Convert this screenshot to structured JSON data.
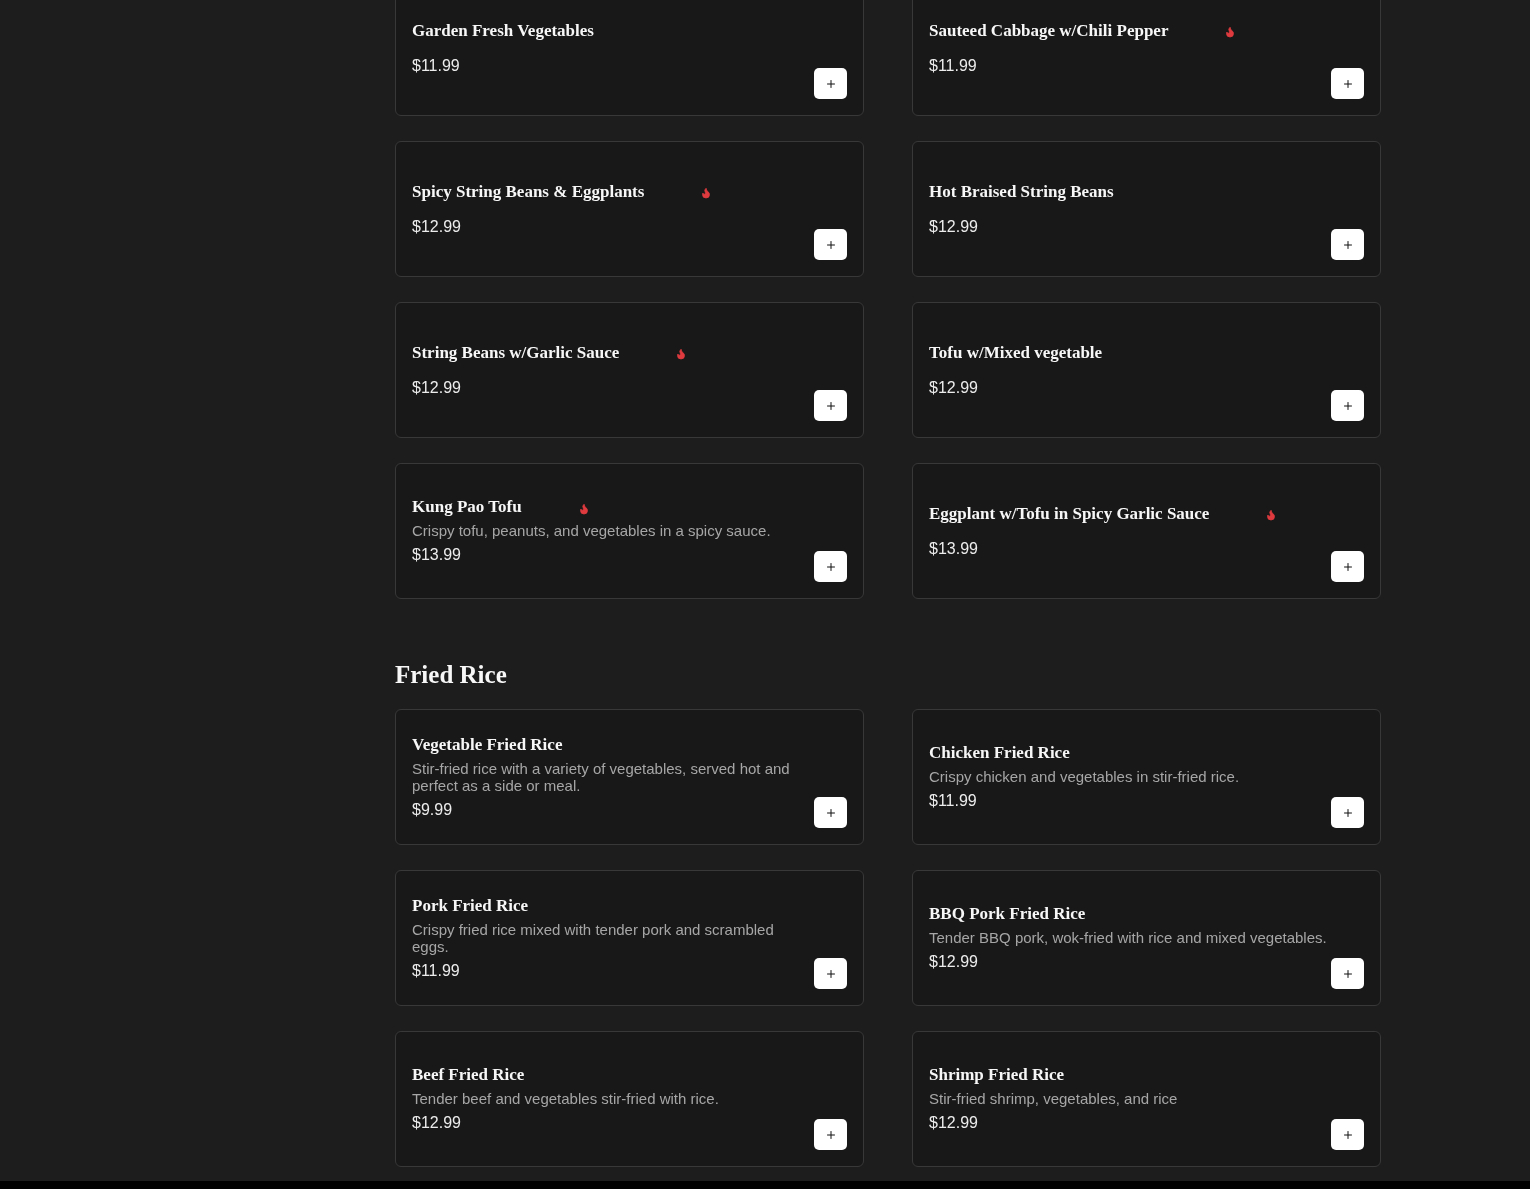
{
  "sections": [
    {
      "items": [
        {
          "name": "Garden Fresh Vegetables",
          "price": "$11.99",
          "spicy": false
        },
        {
          "name": "Sauteed Cabbage w/Chili Pepper",
          "price": "$11.99",
          "spicy": true
        },
        {
          "name": "Spicy String Beans & Eggplants",
          "price": "$12.99",
          "spicy": true
        },
        {
          "name": "Hot Braised String Beans",
          "price": "$12.99",
          "spicy": false
        },
        {
          "name": "String Beans w/Garlic Sauce",
          "price": "$12.99",
          "spicy": true
        },
        {
          "name": "Tofu w/Mixed vegetable",
          "price": "$12.99",
          "spicy": false
        },
        {
          "name": "Kung Pao Tofu",
          "description": "Crispy tofu, peanuts, and vegetables in a spicy sauce.",
          "price": "$13.99",
          "spicy": true
        },
        {
          "name": "Eggplant w/Tofu in Spicy Garlic Sauce",
          "price": "$13.99",
          "spicy": true
        }
      ]
    },
    {
      "title": "Fried Rice",
      "items": [
        {
          "name": "Vegetable Fried Rice",
          "description": "Stir-fried rice with a variety of vegetables, served hot and perfect as a side or meal.",
          "price": "$9.99",
          "spicy": false
        },
        {
          "name": "Chicken Fried Rice",
          "description": "Crispy chicken and vegetables in stir-fried rice.",
          "price": "$11.99",
          "spicy": false
        },
        {
          "name": "Pork Fried Rice",
          "description": "Crispy fried rice mixed with tender pork and scrambled eggs.",
          "price": "$11.99",
          "spicy": false
        },
        {
          "name": "BBQ Pork Fried Rice",
          "description": "Tender BBQ pork, wok-fried with rice and mixed vegetables.",
          "price": "$12.99",
          "spicy": false
        },
        {
          "name": "Beef Fried Rice",
          "description": "Tender beef and vegetables stir-fried with rice.",
          "price": "$12.99",
          "spicy": false
        },
        {
          "name": "Shrimp Fried Rice",
          "description": "Stir-fried shrimp, vegetables, and rice",
          "price": "$12.99",
          "spicy": false
        }
      ]
    }
  ]
}
